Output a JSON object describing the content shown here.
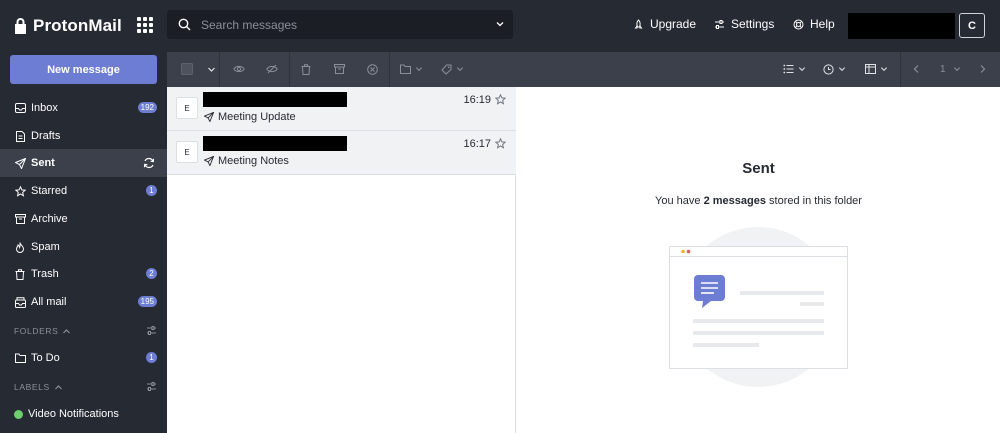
{
  "brand": {
    "name": "ProtonMail"
  },
  "search": {
    "placeholder": "Search messages"
  },
  "topnav": {
    "upgrade": "Upgrade",
    "settings": "Settings",
    "help": "Help",
    "avatar_initial": "C"
  },
  "sidebar": {
    "new_message": "New message",
    "items": [
      {
        "label": "Inbox",
        "badge": "192",
        "icon": "inbox-icon"
      },
      {
        "label": "Drafts",
        "badge": "",
        "icon": "file-icon"
      },
      {
        "label": "Sent",
        "badge": "",
        "icon": "paper-plane-icon",
        "active": true
      },
      {
        "label": "Starred",
        "badge": "1",
        "icon": "star-icon"
      },
      {
        "label": "Archive",
        "badge": "",
        "icon": "archive-icon"
      },
      {
        "label": "Spam",
        "badge": "",
        "icon": "fire-icon"
      },
      {
        "label": "Trash",
        "badge": "2",
        "icon": "trash-icon"
      },
      {
        "label": "All mail",
        "badge": "195",
        "icon": "all-mail-icon"
      }
    ],
    "folders_label": "FOLDERS",
    "folders": [
      {
        "label": "To Do",
        "badge": "1"
      }
    ],
    "labels_label": "LABELS",
    "labels": [
      {
        "label": "Video Notifications",
        "color": "#6fcf6f"
      }
    ]
  },
  "toolbar": {
    "page": "1"
  },
  "messages": [
    {
      "initial": "E",
      "time": "16:19",
      "subject": "Meeting Update"
    },
    {
      "initial": "E",
      "time": "16:17",
      "subject": "Meeting Notes"
    }
  ],
  "pane": {
    "title": "Sent",
    "info_prefix": "You have",
    "info_count": "2 messages",
    "info_suffix": "stored in this folder"
  },
  "colors": {
    "accent": "#6d7dd4",
    "sidebar": "#262a33",
    "toolbar": "#3b404b"
  }
}
